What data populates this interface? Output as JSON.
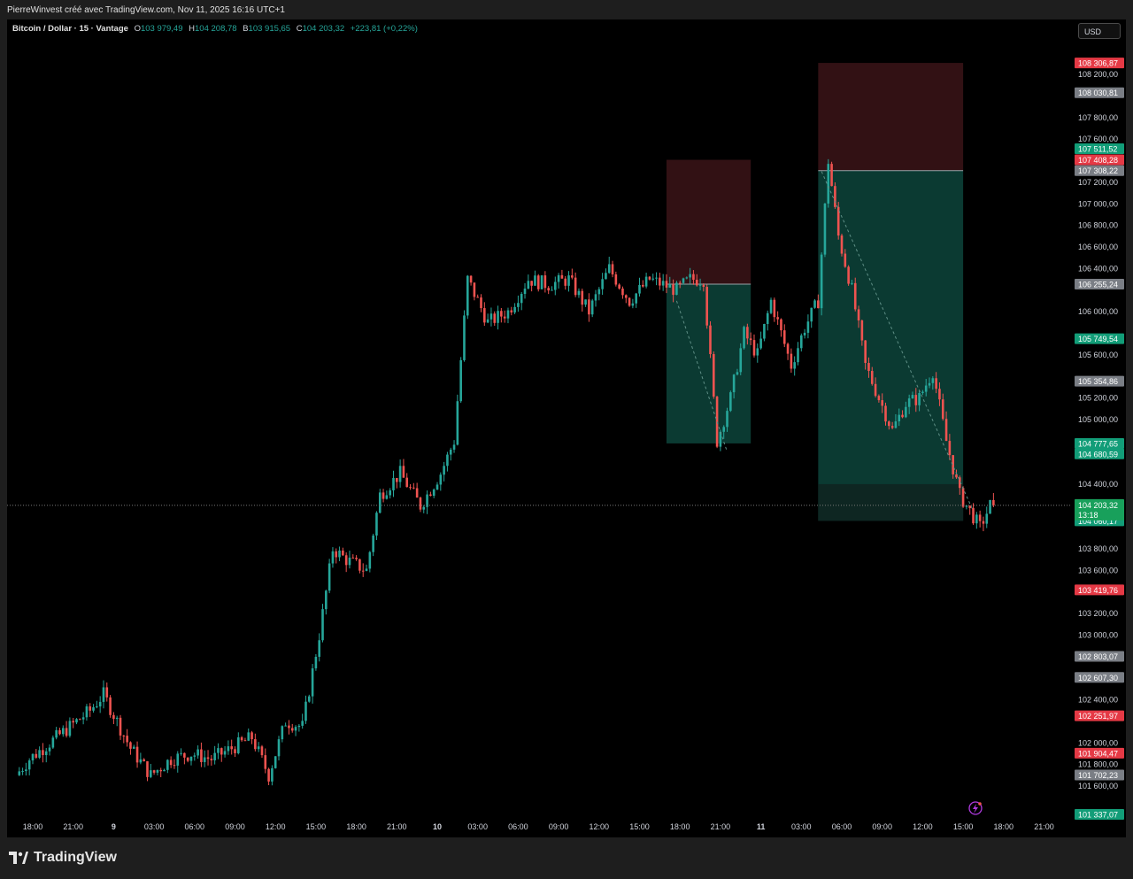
{
  "attribution": "PierreWinvest créé avec TradingView.com, Nov 11, 2025 16:16 UTC+1",
  "legend": {
    "symbol": "Bitcoin / Dollar · 15 · Vantage",
    "o_label": "O",
    "o_value": "103 979,49",
    "h_label": "H",
    "h_value": "104 208,78",
    "l_label": "B",
    "l_value": "103 915,65",
    "c_label": "C",
    "c_value": "104 203,32",
    "change": "+223,81 (+0,22%)"
  },
  "currency": "USD",
  "footer": {
    "brand": "TradingView"
  },
  "colors": {
    "up": "#26a69a",
    "down": "#ef5350",
    "profit_zone": "#0b3a32",
    "loss_zone": "#321114",
    "axis_text": "#d1d4dc"
  },
  "chart_data": {
    "type": "candlestick",
    "symbol": "Bitcoin / Dollar",
    "interval": "15",
    "ylim": [
      101337.07,
      108480
    ],
    "y_ticks": [
      {
        "v": 108200,
        "t": "108 200,00"
      },
      {
        "v": 107800,
        "t": "107 800,00"
      },
      {
        "v": 107600,
        "t": "107 600,00"
      },
      {
        "v": 107200,
        "t": "107 200,00"
      },
      {
        "v": 107000,
        "t": "107 000,00"
      },
      {
        "v": 106800,
        "t": "106 800,00"
      },
      {
        "v": 106600,
        "t": "106 600,00"
      },
      {
        "v": 106400,
        "t": "106 400,00"
      },
      {
        "v": 106000,
        "t": "106 000,00"
      },
      {
        "v": 105600,
        "t": "105 600,00"
      },
      {
        "v": 105200,
        "t": "105 200,00"
      },
      {
        "v": 105000,
        "t": "105 000,00"
      },
      {
        "v": 104400,
        "t": "104 400,00"
      },
      {
        "v": 103800,
        "t": "103 800,00"
      },
      {
        "v": 103600,
        "t": "103 600,00"
      },
      {
        "v": 103200,
        "t": "103 200,00"
      },
      {
        "v": 103000,
        "t": "103 000,00"
      },
      {
        "v": 102400,
        "t": "102 400,00"
      },
      {
        "v": 102000,
        "t": "102 000,00"
      },
      {
        "v": 101800,
        "t": "101 800,00"
      },
      {
        "v": 101600,
        "t": "101 600,00"
      }
    ],
    "price_tags": [
      {
        "v": 108306.87,
        "t": "108 306,87",
        "c": "red"
      },
      {
        "v": 108030.81,
        "t": "108 030,81",
        "c": "gray"
      },
      {
        "v": 107511.52,
        "t": "107 511,52",
        "c": "green"
      },
      {
        "v": 107408.28,
        "t": "107 408,28",
        "c": "red"
      },
      {
        "v": 107308.22,
        "t": "107 308,22",
        "c": "gray"
      },
      {
        "v": 106255.24,
        "t": "106 255,24",
        "c": "gray"
      },
      {
        "v": 105749.54,
        "t": "105 749,54",
        "c": "green"
      },
      {
        "v": 105354.86,
        "t": "105 354,86",
        "c": "gray"
      },
      {
        "v": 104777.65,
        "t": "104 777,65",
        "c": "green"
      },
      {
        "v": 104680.59,
        "t": "104 680,59",
        "c": "green"
      },
      {
        "v": 104060.17,
        "t": "104 060,17",
        "c": "green"
      },
      {
        "v": 103419.76,
        "t": "103 419,76",
        "c": "red"
      },
      {
        "v": 102803.07,
        "t": "102 803,07",
        "c": "gray"
      },
      {
        "v": 102607.3,
        "t": "102 607,30",
        "c": "gray"
      },
      {
        "v": 102251.97,
        "t": "102 251,97",
        "c": "red"
      },
      {
        "v": 101904.47,
        "t": "101 904,47",
        "c": "red"
      },
      {
        "v": 101702.23,
        "t": "101 702,23",
        "c": "gray"
      },
      {
        "v": 101337.07,
        "t": "101 337,07",
        "c": "green"
      }
    ],
    "last_price": {
      "v": 104203.32,
      "t": "104 203,32",
      "countdown": "13:18"
    },
    "x_ticks": [
      "18:00",
      "21:00",
      "9",
      "03:00",
      "06:00",
      "09:00",
      "12:00",
      "15:00",
      "18:00",
      "21:00",
      "10",
      "03:00",
      "06:00",
      "09:00",
      "12:00",
      "15:00",
      "18:00",
      "21:00",
      "11",
      "03:00",
      "06:00",
      "09:00",
      "12:00",
      "15:00",
      "18:00",
      "21:00"
    ],
    "bars_per_tick": 12,
    "bars_before_first_tick": 4,
    "total_bars": 290,
    "short_positions": [
      {
        "start_bar": 192,
        "end_bar": 217,
        "entry": 106255.24,
        "stop": 107408.28,
        "target": 104777.65
      },
      {
        "start_bar": 237,
        "end_bar": 280,
        "entry": 107308.22,
        "stop": 108306.87,
        "target": 104060.17,
        "mid_level": 104400
      }
    ],
    "path_points": [
      [
        0,
        101700
      ],
      [
        4,
        101850
      ],
      [
        10,
        102000
      ],
      [
        16,
        102150
      ],
      [
        22,
        102300
      ],
      [
        26,
        102450
      ],
      [
        30,
        102200
      ],
      [
        34,
        101950
      ],
      [
        40,
        101700
      ],
      [
        46,
        101850
      ],
      [
        52,
        101900
      ],
      [
        58,
        101850
      ],
      [
        64,
        101950
      ],
      [
        70,
        102050
      ],
      [
        75,
        101700
      ],
      [
        80,
        102200
      ],
      [
        85,
        102150
      ],
      [
        90,
        103000
      ],
      [
        94,
        103800
      ],
      [
        98,
        103700
      ],
      [
        104,
        103600
      ],
      [
        108,
        104300
      ],
      [
        114,
        104500
      ],
      [
        120,
        104200
      ],
      [
        126,
        104500
      ],
      [
        130,
        104800
      ],
      [
        134,
        106300
      ],
      [
        140,
        105900
      ],
      [
        146,
        106000
      ],
      [
        152,
        106300
      ],
      [
        158,
        106250
      ],
      [
        164,
        106300
      ],
      [
        170,
        106000
      ],
      [
        176,
        106400
      ],
      [
        182,
        106100
      ],
      [
        188,
        106300
      ],
      [
        192,
        106250
      ],
      [
        196,
        106200
      ],
      [
        200,
        106300
      ],
      [
        204,
        106300
      ],
      [
        208,
        104800
      ],
      [
        212,
        105200
      ],
      [
        216,
        105800
      ],
      [
        220,
        105600
      ],
      [
        224,
        106100
      ],
      [
        230,
        105500
      ],
      [
        234,
        105850
      ],
      [
        238,
        106100
      ],
      [
        241,
        107400
      ],
      [
        244,
        106700
      ],
      [
        248,
        106200
      ],
      [
        252,
        105500
      ],
      [
        256,
        105200
      ],
      [
        260,
        104900
      ],
      [
        264,
        105150
      ],
      [
        268,
        105200
      ],
      [
        272,
        105450
      ],
      [
        276,
        104800
      ],
      [
        280,
        104300
      ],
      [
        284,
        104100
      ],
      [
        286,
        104000
      ],
      [
        289,
        104203.32
      ]
    ]
  }
}
